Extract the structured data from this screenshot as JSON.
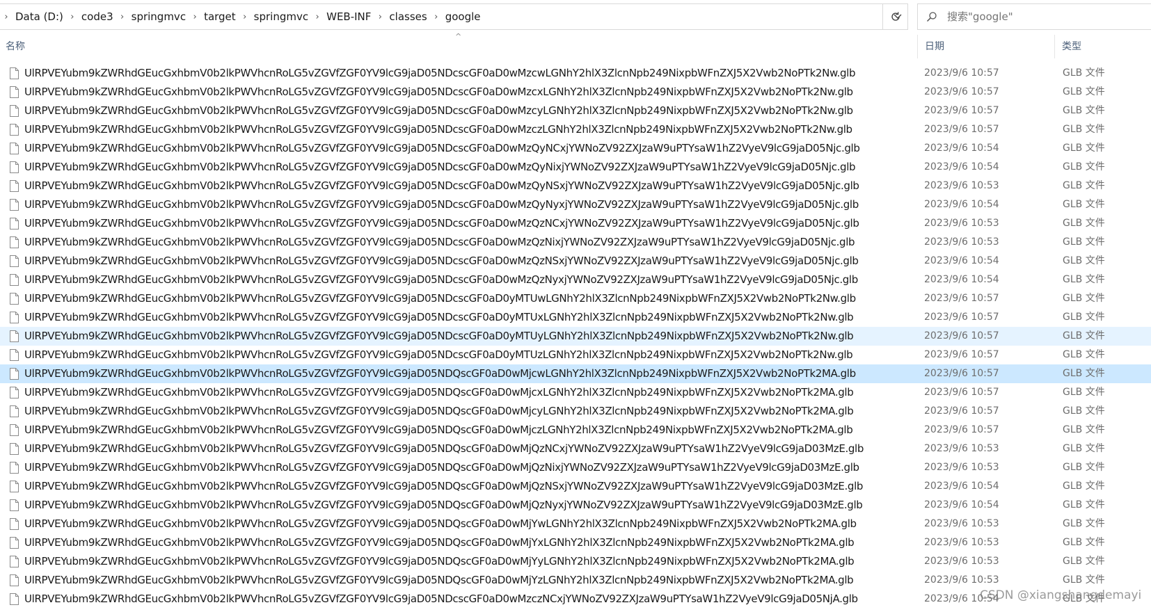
{
  "breadcrumb": [
    "Data (D:)",
    "code3",
    "springmvc",
    "target",
    "springmvc",
    "WEB-INF",
    "classes",
    "google"
  ],
  "search": {
    "placeholder": "搜索\"google\""
  },
  "columns": {
    "name": "名称",
    "date": "日期",
    "type": "类型"
  },
  "files": [
    {
      "name": "UlRPVEYubm9kZWRhdGEucGxhbmV0b2lkPWVhcnRoLG5vZGVfZGF0YV9lcG9jaD05NDcscGF0aD0wMzcwLGNhY2hlX3ZlcnNpb249NixpbWFnZXJ5X2Vwb2NoPTk2Nw.glb",
      "date": "2023/9/6 10:57",
      "type": "GLB 文件"
    },
    {
      "name": "UlRPVEYubm9kZWRhdGEucGxhbmV0b2lkPWVhcnRoLG5vZGVfZGF0YV9lcG9jaD05NDcscGF0aD0wMzcxLGNhY2hlX3ZlcnNpb249NixpbWFnZXJ5X2Vwb2NoPTk2Nw.glb",
      "date": "2023/9/6 10:57",
      "type": "GLB 文件"
    },
    {
      "name": "UlRPVEYubm9kZWRhdGEucGxhbmV0b2lkPWVhcnRoLG5vZGVfZGF0YV9lcG9jaD05NDcscGF0aD0wMzcyLGNhY2hlX3ZlcnNpb249NixpbWFnZXJ5X2Vwb2NoPTk2Nw.glb",
      "date": "2023/9/6 10:57",
      "type": "GLB 文件"
    },
    {
      "name": "UlRPVEYubm9kZWRhdGEucGxhbmV0b2lkPWVhcnRoLG5vZGVfZGF0YV9lcG9jaD05NDcscGF0aD0wMzczLGNhY2hlX3ZlcnNpb249NixpbWFnZXJ5X2Vwb2NoPTk2Nw.glb",
      "date": "2023/9/6 10:57",
      "type": "GLB 文件"
    },
    {
      "name": "UlRPVEYubm9kZWRhdGEucGxhbmV0b2lkPWVhcnRoLG5vZGVfZGF0YV9lcG9jaD05NDcscGF0aD0wMzQyNCxjYWNoZV92ZXJzaW9uPTYsaW1hZ2VyeV9lcG9jaD05Njc.glb",
      "date": "2023/9/6 10:54",
      "type": "GLB 文件"
    },
    {
      "name": "UlRPVEYubm9kZWRhdGEucGxhbmV0b2lkPWVhcnRoLG5vZGVfZGF0YV9lcG9jaD05NDcscGF0aD0wMzQyNixjYWNoZV92ZXJzaW9uPTYsaW1hZ2VyeV9lcG9jaD05Njc.glb",
      "date": "2023/9/6 10:54",
      "type": "GLB 文件"
    },
    {
      "name": "UlRPVEYubm9kZWRhdGEucGxhbmV0b2lkPWVhcnRoLG5vZGVfZGF0YV9lcG9jaD05NDcscGF0aD0wMzQyNSxjYWNoZV92ZXJzaW9uPTYsaW1hZ2VyeV9lcG9jaD05Njc.glb",
      "date": "2023/9/6 10:53",
      "type": "GLB 文件"
    },
    {
      "name": "UlRPVEYubm9kZWRhdGEucGxhbmV0b2lkPWVhcnRoLG5vZGVfZGF0YV9lcG9jaD05NDcscGF0aD0wMzQyNyxjYWNoZV92ZXJzaW9uPTYsaW1hZ2VyeV9lcG9jaD05Njc.glb",
      "date": "2023/9/6 10:54",
      "type": "GLB 文件"
    },
    {
      "name": "UlRPVEYubm9kZWRhdGEucGxhbmV0b2lkPWVhcnRoLG5vZGVfZGF0YV9lcG9jaD05NDcscGF0aD0wMzQzNCxjYWNoZV92ZXJzaW9uPTYsaW1hZ2VyeV9lcG9jaD05Njc.glb",
      "date": "2023/9/6 10:53",
      "type": "GLB 文件"
    },
    {
      "name": "UlRPVEYubm9kZWRhdGEucGxhbmV0b2lkPWVhcnRoLG5vZGVfZGF0YV9lcG9jaD05NDcscGF0aD0wMzQzNixjYWNoZV92ZXJzaW9uPTYsaW1hZ2VyeV9lcG9jaD05Njc.glb",
      "date": "2023/9/6 10:53",
      "type": "GLB 文件"
    },
    {
      "name": "UlRPVEYubm9kZWRhdGEucGxhbmV0b2lkPWVhcnRoLG5vZGVfZGF0YV9lcG9jaD05NDcscGF0aD0wMzQzNSxjYWNoZV92ZXJzaW9uPTYsaW1hZ2VyeV9lcG9jaD05Njc.glb",
      "date": "2023/9/6 10:54",
      "type": "GLB 文件"
    },
    {
      "name": "UlRPVEYubm9kZWRhdGEucGxhbmV0b2lkPWVhcnRoLG5vZGVfZGF0YV9lcG9jaD05NDcscGF0aD0wMzQzNyxjYWNoZV92ZXJzaW9uPTYsaW1hZ2VyeV9lcG9jaD05Njc.glb",
      "date": "2023/9/6 10:54",
      "type": "GLB 文件"
    },
    {
      "name": "UlRPVEYubm9kZWRhdGEucGxhbmV0b2lkPWVhcnRoLG5vZGVfZGF0YV9lcG9jaD05NDcscGF0aD0yMTUwLGNhY2hlX3ZlcnNpb249NixpbWFnZXJ5X2Vwb2NoPTk2Nw.glb",
      "date": "2023/9/6 10:57",
      "type": "GLB 文件"
    },
    {
      "name": "UlRPVEYubm9kZWRhdGEucGxhbmV0b2lkPWVhcnRoLG5vZGVfZGF0YV9lcG9jaD05NDcscGF0aD0yMTUxLGNhY2hlX3ZlcnNpb249NixpbWFnZXJ5X2Vwb2NoPTk2Nw.glb",
      "date": "2023/9/6 10:57",
      "type": "GLB 文件"
    },
    {
      "name": "UlRPVEYubm9kZWRhdGEucGxhbmV0b2lkPWVhcnRoLG5vZGVfZGF0YV9lcG9jaD05NDcscGF0aD0yMTUyLGNhY2hlX3ZlcnNpb249NixpbWFnZXJ5X2Vwb2NoPTk2Nw.glb",
      "date": "2023/9/6 10:57",
      "type": "GLB 文件"
    },
    {
      "name": "UlRPVEYubm9kZWRhdGEucGxhbmV0b2lkPWVhcnRoLG5vZGVfZGF0YV9lcG9jaD05NDcscGF0aD0yMTUzLGNhY2hlX3ZlcnNpb249NixpbWFnZXJ5X2Vwb2NoPTk2Nw.glb",
      "date": "2023/9/6 10:57",
      "type": "GLB 文件"
    },
    {
      "name": "UlRPVEYubm9kZWRhdGEucGxhbmV0b2lkPWVhcnRoLG5vZGVfZGF0YV9lcG9jaD05NDQscGF0aD0wMjcwLGNhY2hlX3ZlcnNpb249NixpbWFnZXJ5X2Vwb2NoPTk2MA.glb",
      "date": "2023/9/6 10:57",
      "type": "GLB 文件"
    },
    {
      "name": "UlRPVEYubm9kZWRhdGEucGxhbmV0b2lkPWVhcnRoLG5vZGVfZGF0YV9lcG9jaD05NDQscGF0aD0wMjcxLGNhY2hlX3ZlcnNpb249NixpbWFnZXJ5X2Vwb2NoPTk2MA.glb",
      "date": "2023/9/6 10:57",
      "type": "GLB 文件"
    },
    {
      "name": "UlRPVEYubm9kZWRhdGEucGxhbmV0b2lkPWVhcnRoLG5vZGVfZGF0YV9lcG9jaD05NDQscGF0aD0wMjcyLGNhY2hlX3ZlcnNpb249NixpbWFnZXJ5X2Vwb2NoPTk2MA.glb",
      "date": "2023/9/6 10:57",
      "type": "GLB 文件"
    },
    {
      "name": "UlRPVEYubm9kZWRhdGEucGxhbmV0b2lkPWVhcnRoLG5vZGVfZGF0YV9lcG9jaD05NDQscGF0aD0wMjczLGNhY2hlX3ZlcnNpb249NixpbWFnZXJ5X2Vwb2NoPTk2MA.glb",
      "date": "2023/9/6 10:57",
      "type": "GLB 文件"
    },
    {
      "name": "UlRPVEYubm9kZWRhdGEucGxhbmV0b2lkPWVhcnRoLG5vZGVfZGF0YV9lcG9jaD05NDQscGF0aD0wMjQzNCxjYWNoZV92ZXJzaW9uPTYsaW1hZ2VyeV9lcG9jaD03MzE.glb",
      "date": "2023/9/6 10:53",
      "type": "GLB 文件"
    },
    {
      "name": "UlRPVEYubm9kZWRhdGEucGxhbmV0b2lkPWVhcnRoLG5vZGVfZGF0YV9lcG9jaD05NDQscGF0aD0wMjQzNixjYWNoZV92ZXJzaW9uPTYsaW1hZ2VyeV9lcG9jaD03MzE.glb",
      "date": "2023/9/6 10:53",
      "type": "GLB 文件"
    },
    {
      "name": "UlRPVEYubm9kZWRhdGEucGxhbmV0b2lkPWVhcnRoLG5vZGVfZGF0YV9lcG9jaD05NDQscGF0aD0wMjQzNSxjYWNoZV92ZXJzaW9uPTYsaW1hZ2VyeV9lcG9jaD03MzE.glb",
      "date": "2023/9/6 10:54",
      "type": "GLB 文件"
    },
    {
      "name": "UlRPVEYubm9kZWRhdGEucGxhbmV0b2lkPWVhcnRoLG5vZGVfZGF0YV9lcG9jaD05NDQscGF0aD0wMjQzNyxjYWNoZV92ZXJzaW9uPTYsaW1hZ2VyeV9lcG9jaD03MzE.glb",
      "date": "2023/9/6 10:54",
      "type": "GLB 文件"
    },
    {
      "name": "UlRPVEYubm9kZWRhdGEucGxhbmV0b2lkPWVhcnRoLG5vZGVfZGF0YV9lcG9jaD05NDQscGF0aD0wMjYwLGNhY2hlX3ZlcnNpb249NixpbWFnZXJ5X2Vwb2NoPTk2MA.glb",
      "date": "2023/9/6 10:53",
      "type": "GLB 文件"
    },
    {
      "name": "UlRPVEYubm9kZWRhdGEucGxhbmV0b2lkPWVhcnRoLG5vZGVfZGF0YV9lcG9jaD05NDQscGF0aD0wMjYxLGNhY2hlX3ZlcnNpb249NixpbWFnZXJ5X2Vwb2NoPTk2MA.glb",
      "date": "2023/9/6 10:53",
      "type": "GLB 文件"
    },
    {
      "name": "UlRPVEYubm9kZWRhdGEucGxhbmV0b2lkPWVhcnRoLG5vZGVfZGF0YV9lcG9jaD05NDQscGF0aD0wMjYyLGNhY2hlX3ZlcnNpb249NixpbWFnZXJ5X2Vwb2NoPTk2MA.glb",
      "date": "2023/9/6 10:53",
      "type": "GLB 文件"
    },
    {
      "name": "UlRPVEYubm9kZWRhdGEucGxhbmV0b2lkPWVhcnRoLG5vZGVfZGF0YV9lcG9jaD05NDQscGF0aD0wMjYzLGNhY2hlX3ZlcnNpb249NixpbWFnZXJ5X2Vwb2NoPTk2MA.glb",
      "date": "2023/9/6 10:53",
      "type": "GLB 文件"
    },
    {
      "name": "UlRPVEYubm9kZWRhdGEucGxhbmV0b2lkPWVhcnRoLG5vZGVfZGF0YV9lcG9jaD05NDcscGF0aD0wMzczNCxjYWNoZV92ZXJzaW9uPTYsaW1hZ2VyeV9lcG9jaD05NjA.glb",
      "date": "2023/9/6 10:54",
      "type": "GLB 文件"
    }
  ],
  "hover_row": 14,
  "selected_row": 16,
  "watermark": "CSDN @xiangshangdemayi",
  "colors": {
    "hover": "#e5f3ff",
    "selected": "#cce8ff",
    "header_text": "#4c607a"
  }
}
